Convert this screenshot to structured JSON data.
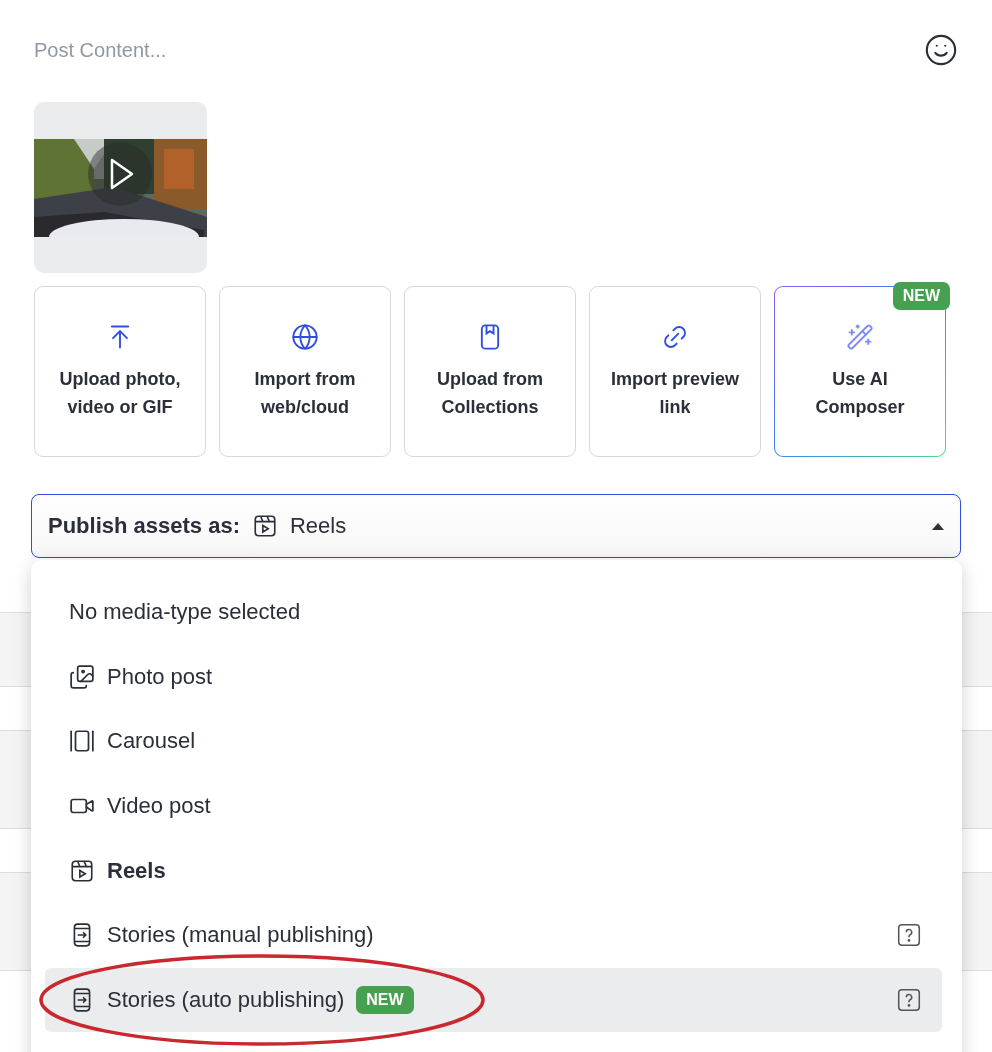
{
  "composer": {
    "placeholder": "Post Content..."
  },
  "media": [
    {
      "kind": "picture",
      "playable": true
    }
  ],
  "sources": [
    {
      "kind": "upload",
      "label": "Upload photo, video or GIF"
    },
    {
      "kind": "web",
      "label": "Import from web/cloud"
    },
    {
      "kind": "collections",
      "label": "Upload from Collections"
    },
    {
      "kind": "link",
      "label": "Import preview link"
    },
    {
      "kind": "ai",
      "label": "Use AI Composer",
      "badge": "NEW"
    }
  ],
  "publish_select": {
    "label": "Publish assets as:",
    "value": "Reels",
    "kind": "reels",
    "expanded": true
  },
  "menu": [
    {
      "kind": "none",
      "label": "No media-type selected",
      "selected": false,
      "hovered": false,
      "help": false,
      "circled": false
    },
    {
      "label": "Photo post",
      "selected": false,
      "hovered": false,
      "help": false,
      "circled": false
    },
    {
      "kind": "carousel",
      "label": "Carousel",
      "selected": false,
      "hovered": false,
      "help": false,
      "circled": false
    },
    {
      "kind": "video",
      "label": "Video post",
      "selected": false,
      "hovered": false,
      "help": false,
      "circled": false
    },
    {
      "kind": "reels",
      "label": "Reels",
      "selected": true,
      "hovered": false,
      "help": false,
      "circled": false
    },
    {
      "kind": "story",
      "label": "Stories (manual publishing)",
      "selected": false,
      "hovered": false,
      "help": true,
      "circled": false
    },
    {
      "kind": "story",
      "label": "Stories (auto publishing)",
      "selected": false,
      "hovered": true,
      "help": true,
      "circled": true,
      "badge": "NEW"
    }
  ]
}
